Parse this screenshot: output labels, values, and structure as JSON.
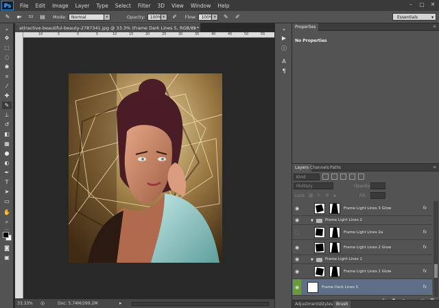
{
  "menubar": {
    "logo": "Ps",
    "items": [
      "File",
      "Edit",
      "Image",
      "Layer",
      "Type",
      "Select",
      "Filter",
      "3D",
      "View",
      "Window",
      "Help"
    ]
  },
  "options": {
    "mode_label": "Mode:",
    "mode_value": "Normal",
    "opacity_label": "Opacity:",
    "opacity_value": "100%",
    "flow_label": "Flow:",
    "flow_value": "100%",
    "brush_size": "53",
    "workspace": "Essentials"
  },
  "document": {
    "tab_title": "attractive-beautiful-beauty-2787341.jpg @ 33.3% (Frame Dark Lines 5, RGB/8) *",
    "ruler_ticks": [
      "10",
      "5",
      "0",
      "5",
      "10",
      "15",
      "20",
      "25",
      "30",
      "35",
      "40",
      "45",
      "50",
      "55"
    ]
  },
  "status": {
    "zoom": "33.33%",
    "doc_size": "Doc: 5.74M/299.2M"
  },
  "properties": {
    "tab": "Properties",
    "message": "No Properties"
  },
  "layers": {
    "tabs": [
      "Layers",
      "Channels",
      "Paths"
    ],
    "kind": "Kind",
    "blend_mode": "Multiply",
    "opacity_label": "Opacity:",
    "lock_label": "Lock:",
    "fill_label": "Fill:",
    "rows": [
      {
        "name": "Frame Light Lines 3 Glow",
        "type": "layer",
        "visible": true,
        "fx": true
      },
      {
        "name": "Frame Light Lines 2",
        "type": "group",
        "visible": true
      },
      {
        "name": "Frame Light Lines 2a",
        "type": "layer",
        "visible": false,
        "fx": true
      },
      {
        "name": "Frame Light Lines 2 Glow",
        "type": "layer",
        "visible": true,
        "fx": true
      },
      {
        "name": "Frame Light Lines 1",
        "type": "group",
        "visible": true
      },
      {
        "name": "Frame Light Lines 1 Glow",
        "type": "layer",
        "visible": true,
        "fx": true
      },
      {
        "name": "Frame Dark Lines 5",
        "type": "layer",
        "visible": true,
        "fx": true,
        "selected": true
      }
    ],
    "bottom_tabs": [
      "Adjustments",
      "Styles",
      "Brush"
    ]
  },
  "colors": {
    "selected_row": "#5f6f87",
    "panel": "#535353",
    "frame_selected": "#6a9a3a"
  }
}
